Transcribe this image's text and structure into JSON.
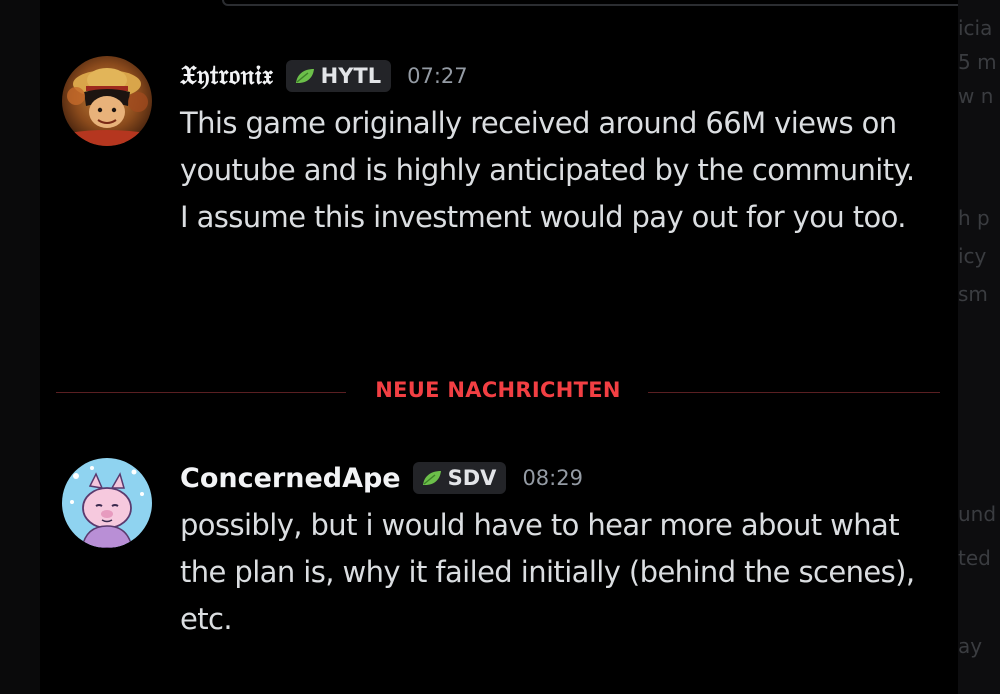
{
  "messages": [
    {
      "username": "𝔛𝔶𝔱𝔯𝔬𝔫𝔦𝔵",
      "clan_tag": "HYTL",
      "timestamp": "07:27",
      "lines": [
        "This game originally received around 66M views on youtube and is highly anticipated by the community.",
        "I assume this investment would pay out for you too."
      ]
    },
    {
      "username": "ConcernedApe",
      "clan_tag": "SDV",
      "timestamp": "08:29",
      "lines": [
        "possibly, but i would have to hear more about what the plan is, why it failed initially (behind the scenes), etc."
      ]
    }
  ],
  "divider": {
    "label": "NEUE NACHRICHTEN"
  },
  "right_panel_fragments": [
    "icia",
    "5 m",
    "w n",
    "h p",
    "icy",
    "sm",
    "und",
    "ted",
    "ay"
  ],
  "colors": {
    "background": "#000000",
    "text": "#dbdee1",
    "username": "#f2f3f5",
    "timestamp": "#949ba4",
    "tag_background": "#232428",
    "leaf": "#6cc04a",
    "new_messages": "#f23f43"
  },
  "icons": {
    "clan_tag": "leaf-icon"
  }
}
